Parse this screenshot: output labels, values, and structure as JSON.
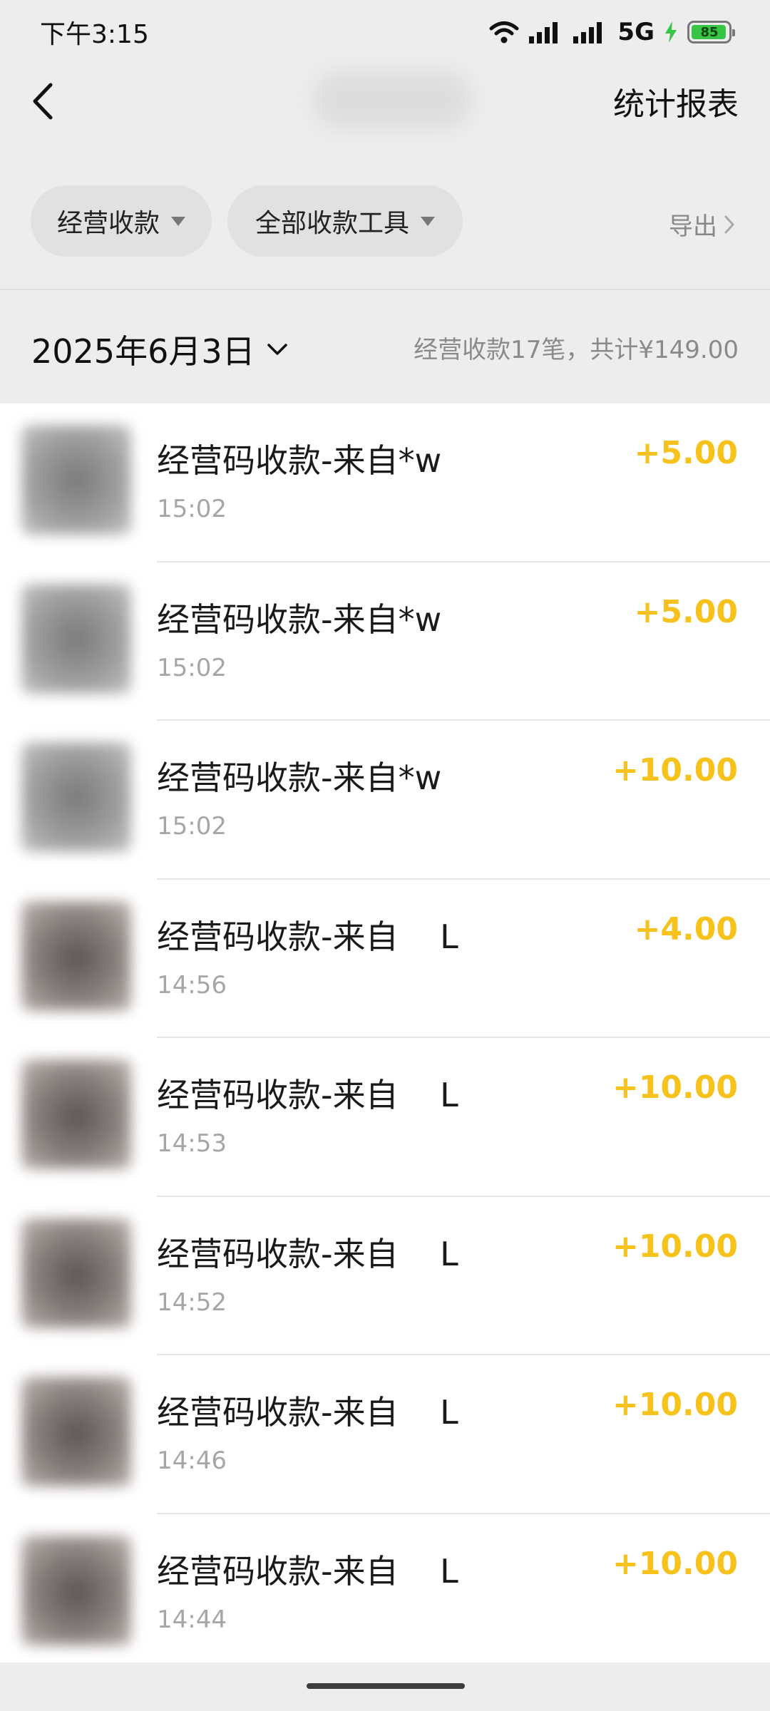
{
  "status_bar": {
    "time": "下午3:15",
    "network": "5G",
    "battery": "85",
    "icons": [
      "wifi-icon",
      "signal-icon",
      "signal-icon",
      "charging-icon",
      "battery-icon"
    ]
  },
  "nav": {
    "back_icon": "chevron-left-icon",
    "report_label": "统计报表"
  },
  "filters": {
    "type_label": "经营收款",
    "tool_label": "全部收款工具",
    "export_label": "导出",
    "caret_icon": "caret-down-icon",
    "export_icon": "chevron-right-icon"
  },
  "date_header": {
    "date": "2025年6月3日",
    "date_icon": "chevron-down-icon",
    "summary": "经营收款17笔，共计¥149.00"
  },
  "transactions": [
    {
      "title": "经营码收款-来自*w",
      "time": "15:02",
      "amount": "+5.00"
    },
    {
      "title": "经营码收款-来自*w",
      "time": "15:02",
      "amount": "+5.00"
    },
    {
      "title": "经营码收款-来自*w",
      "time": "15:02",
      "amount": "+10.00"
    },
    {
      "title": "经营码收款-来自    L",
      "time": "14:56",
      "amount": "+4.00"
    },
    {
      "title": "经营码收款-来自    L",
      "time": "14:53",
      "amount": "+10.00"
    },
    {
      "title": "经营码收款-来自    L",
      "time": "14:52",
      "amount": "+10.00"
    },
    {
      "title": "经营码收款-来自    L",
      "time": "14:46",
      "amount": "+10.00"
    },
    {
      "title": "经营码收款-来自    L",
      "time": "14:44",
      "amount": "+10.00"
    }
  ],
  "colors": {
    "amount": "#f6c21b",
    "background": "#ededed",
    "list_background": "#ffffff",
    "battery_fill": "#38c545"
  }
}
